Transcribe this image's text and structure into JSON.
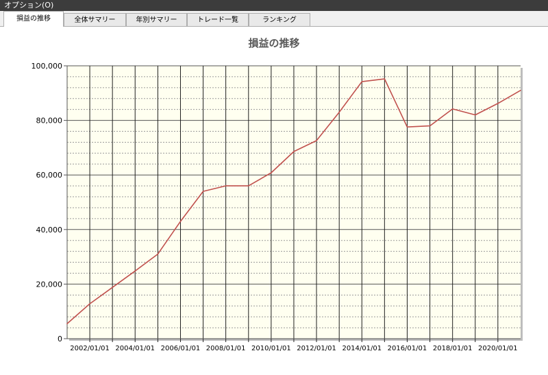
{
  "menu": {
    "options_label": "オプション(O)"
  },
  "tabs": [
    {
      "label": "損益の推移",
      "active": true
    },
    {
      "label": "全体サマリー",
      "active": false
    },
    {
      "label": "年別サマリー",
      "active": false
    },
    {
      "label": "トレード一覧",
      "active": false
    },
    {
      "label": "ランキング",
      "active": false
    }
  ],
  "colors": {
    "plot_bg": "#fffff0",
    "line": "#c0504d",
    "grid": "#000000"
  },
  "chart_data": {
    "type": "line",
    "title": "損益の推移",
    "xlabel": "",
    "ylabel": "",
    "ylim": [
      0,
      100000
    ],
    "xlim": [
      "2001/01/01",
      "2021/01/01"
    ],
    "y_ticks": [
      "0",
      "20,000",
      "40,000",
      "60,000",
      "80,000",
      "100,000"
    ],
    "x_ticks": [
      "2002/01/01",
      "2004/01/01",
      "2006/01/01",
      "2008/01/01",
      "2010/01/01",
      "2012/01/01",
      "2014/01/01",
      "2016/01/01",
      "2018/01/01",
      "2020/01/01"
    ],
    "grid": true,
    "series": [
      {
        "x": [
          "2001/01/01",
          "2002/01/01",
          "2003/01/01",
          "2004/01/01",
          "2005/01/01",
          "2006/01/01",
          "2007/01/01",
          "2008/01/01",
          "2009/01/01",
          "2010/01/01",
          "2011/01/01",
          "2012/01/01",
          "2013/01/01",
          "2014/01/01",
          "2015/01/01",
          "2016/01/01",
          "2017/01/01",
          "2018/01/01",
          "2019/01/01",
          "2020/01/01",
          "2021/01/01"
        ],
        "values": [
          5500,
          12800,
          18800,
          24800,
          31000,
          43000,
          54000,
          56000,
          56000,
          60800,
          68600,
          72600,
          83000,
          94200,
          95200,
          77600,
          78000,
          84200,
          82000,
          86200,
          91000
        ]
      }
    ]
  }
}
